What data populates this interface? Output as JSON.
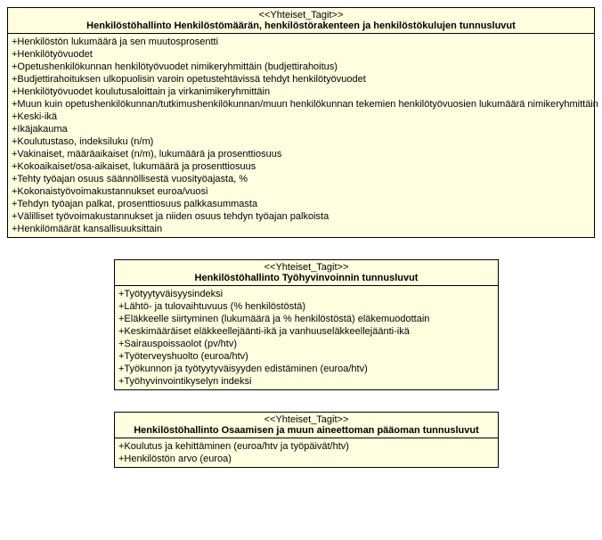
{
  "boxes": [
    {
      "stereotype": "<<Yhteiset_Tagit>>",
      "title": "Henkilöstöhallinto Henkilöstömäärän, henkilöstörakenteen ja henkilöstökulujen tunnusluvut",
      "attrs": [
        "+Henkilöstön lukumäärä ja sen muutosprosentti",
        "+Henkilötyövuodet",
        "+Opetushenkilökunnan henkilötyövuodet nimikeryhmittäin (budjettirahoitus)",
        "+Budjettirahoituksen ulkopuolisin varoin opetustehtävissä tehdyt henkilötyövuodet",
        "+Henkilötyövuodet koulutusaloittain ja virkanimikeryhmittäin",
        "+Muun kuin opetushenkilökunnan/tutkimushenkilökunnan/muun henkilökunnan tekemien henkilötyövuosien lukumäärä nimikeryhmittäin",
        "+Keski-ikä",
        "+Ikäjakauma",
        "+Koulutustaso, indeksiluku (n/m)",
        "+Vakinaiset, määräaikaiset (n/m), lukumäärä ja prosenttiosuus",
        "+Kokoaikaiset/osa-aikaiset, lukumäärä ja prosenttiosuus",
        "+Tehty työajan osuus säännöllisestä vuosityöajasta, %",
        "+Kokonaistyövoimakustannukset euroa/vuosi",
        "+Tehdyn työajan palkat, prosenttiosuus palkkasummasta",
        "+Välilliset työvoimakustannukset ja niiden osuus tehdyn työajan palkoista",
        "+Henkilömäärät kansallisuuksittain"
      ]
    },
    {
      "stereotype": "<<Yhteiset_Tagit>>",
      "title": "Henkilöstöhallinto Työhyvinvoinnin tunnusluvut",
      "attrs": [
        "+Työtyytyväisyysindeksi",
        "+Lähtö- ja tulovaihtuvuus (% henkilöstöstä)",
        "+Eläkkeelle siirtyminen (lukumäärä ja % henkilöstöstä) eläkemuodottain",
        "+Keskimääräiset eläkkeellejäänti-ikä ja vanhuuseläkkeellejäänti-ikä",
        "+Sairauspoissaolot (pv/htv)",
        "+Työterveyshuolto (euroa/htv)",
        "+Työkunnon ja työtyytyväisyyden edistäminen (euroa/htv)",
        "+Työhyvinvointikyselyn indeksi"
      ]
    },
    {
      "stereotype": "<<Yhteiset_Tagit>>",
      "title": "Henkilöstöhallinto Osaamisen ja muun aineettoman pääoman tunnusluvut",
      "attrs": [
        "+Koulutus ja kehittäminen (euroa/htv ja työpäivät/htv)",
        "+Henkilöstön arvo (euroa)"
      ]
    }
  ]
}
